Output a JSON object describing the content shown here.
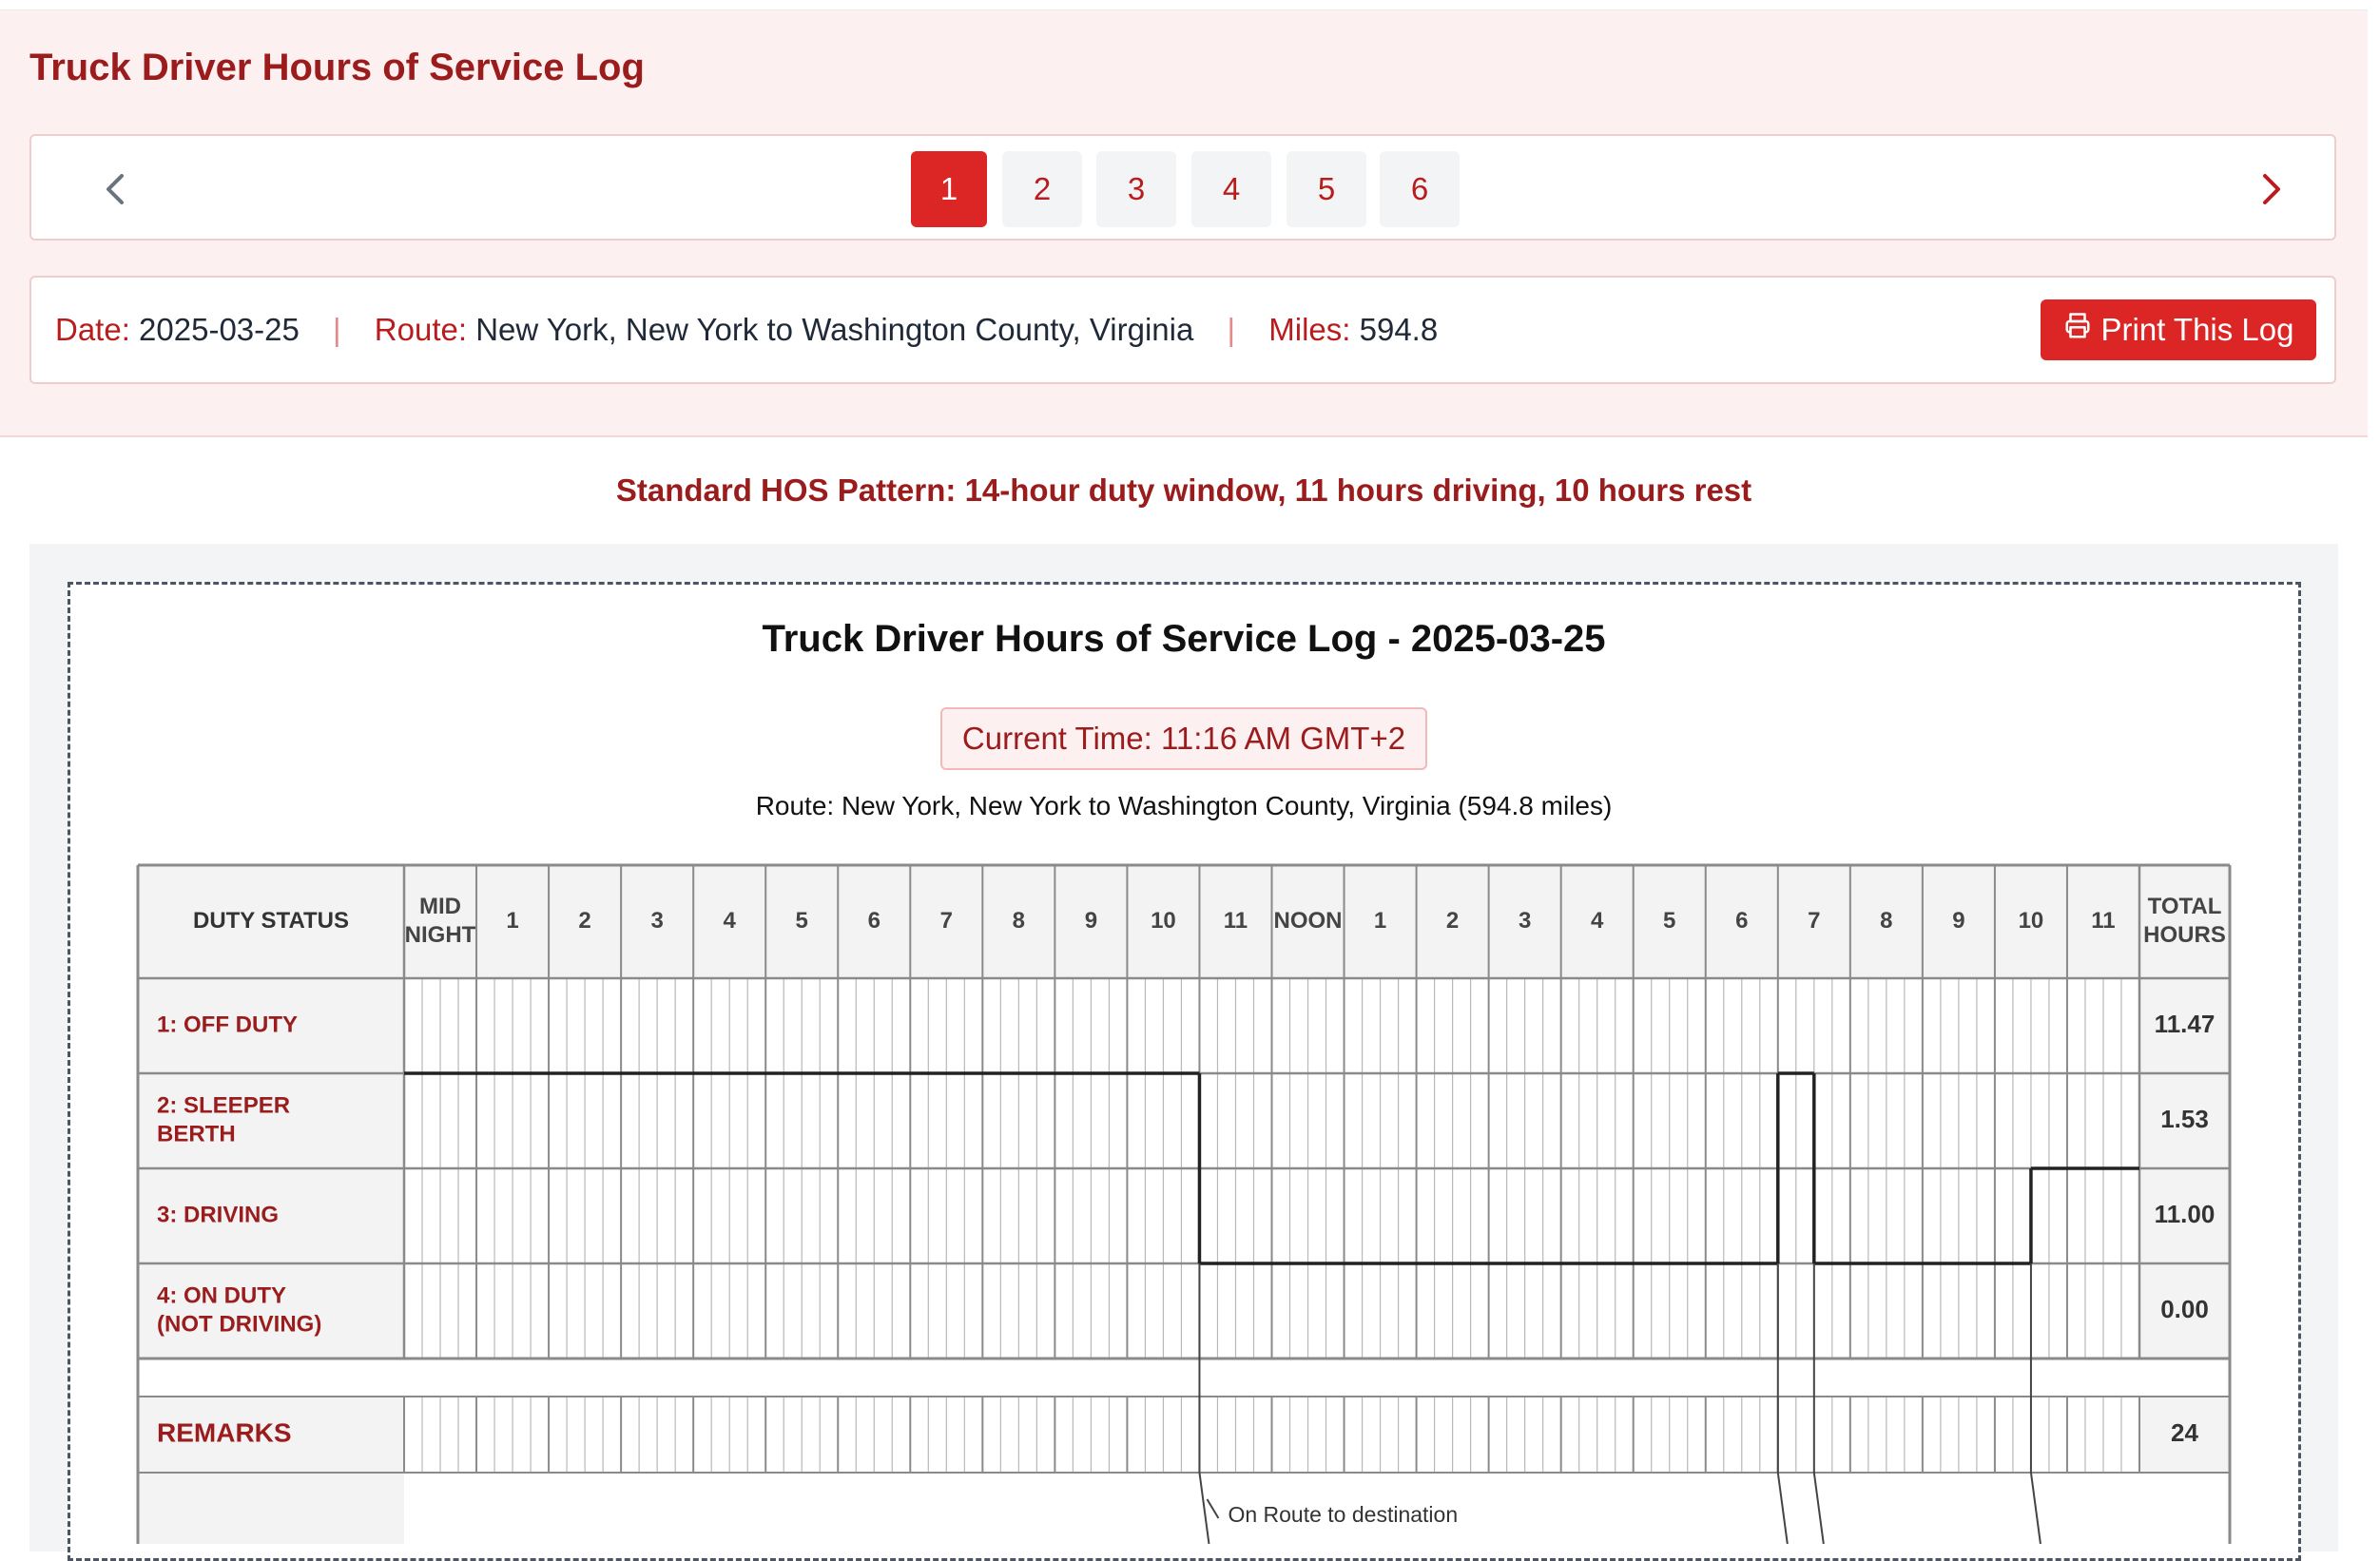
{
  "app": {
    "title": "Truck Driver Hours of Service Log"
  },
  "pagination": {
    "pages": [
      "1",
      "2",
      "3",
      "4",
      "5",
      "6"
    ],
    "active": "1",
    "prev_icon": "chevron-left-icon",
    "next_icon": "chevron-right-icon"
  },
  "summary": {
    "date_label": "Date:",
    "date": "2025-03-25",
    "separator": "|",
    "route_label": "Route:",
    "route": "New York, New York to Washington County, Virginia",
    "miles_label": "Miles:",
    "miles": "594.8",
    "print_label": "Print This Log",
    "print_icon": "printer-icon"
  },
  "pattern_note": "Standard HOS Pattern: 14-hour duty window, 11 hours driving, 10 hours rest",
  "log": {
    "title": "Truck Driver Hours of Service Log - 2025-03-25",
    "current_time": "Current Time: 11:16 AM GMT+2",
    "route_line": "Route: New York, New York to Washington County, Virginia (594.8 miles)",
    "grid": {
      "duty_header": "DUTY STATUS",
      "total_header": [
        "TOTAL",
        "HOURS"
      ],
      "hour_labels": [
        [
          "MID",
          "NIGHT"
        ],
        [
          "1"
        ],
        [
          "2"
        ],
        [
          "3"
        ],
        [
          "4"
        ],
        [
          "5"
        ],
        [
          "6"
        ],
        [
          "7"
        ],
        [
          "8"
        ],
        [
          "9"
        ],
        [
          "10"
        ],
        [
          "11"
        ],
        [
          "NOON"
        ],
        [
          "1"
        ],
        [
          "2"
        ],
        [
          "3"
        ],
        [
          "4"
        ],
        [
          "5"
        ],
        [
          "6"
        ],
        [
          "7"
        ],
        [
          "8"
        ],
        [
          "9"
        ],
        [
          "10"
        ],
        [
          "11"
        ]
      ],
      "rows": [
        {
          "label": [
            "1: OFF DUTY"
          ],
          "total": "11.47"
        },
        {
          "label": [
            "2: SLEEPER",
            "BERTH"
          ],
          "total": "1.53"
        },
        {
          "label": [
            "3: DRIVING"
          ],
          "total": "11.00"
        },
        {
          "label": [
            "4: ON DUTY",
            "(NOT DRIVING)"
          ],
          "total": "0.00"
        }
      ],
      "remarks_label": "REMARKS",
      "remarks_total": "24",
      "duty_line": [
        {
          "status": 2,
          "from": 0,
          "to": 11
        },
        {
          "status": 4,
          "from": 11,
          "to": 19
        },
        {
          "status": 2,
          "from": 19,
          "to": 19.5
        },
        {
          "status": 4,
          "from": 19.5,
          "to": 22.5
        },
        {
          "status": 3,
          "from": 22.5,
          "to": 24
        }
      ],
      "remark_markers": [
        11,
        19,
        19.5,
        22.5
      ],
      "remarks": [
        {
          "hour": 11,
          "text": "On Route to destination"
        }
      ]
    }
  },
  "colors": {
    "brand": "#9b1c1c",
    "accent": "#dc2626",
    "page_bg": "#fdf0f0"
  }
}
